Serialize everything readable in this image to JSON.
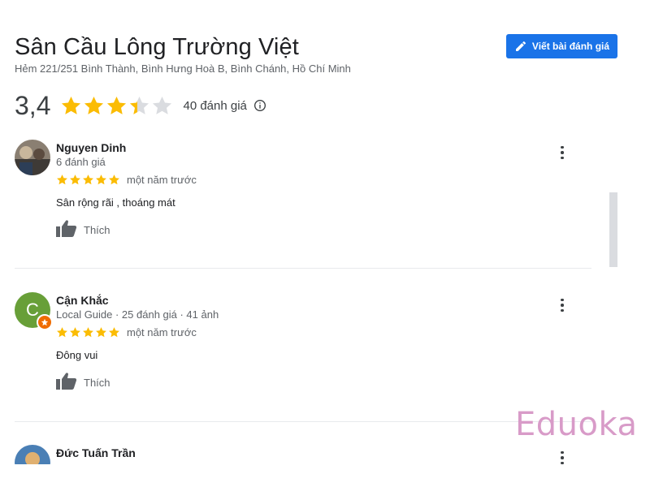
{
  "place": {
    "title": "Sân Cầu Lông Trường Việt",
    "address": "Hẻm 221/251 Bình Thành, Bình Hưng Hoà B, Bình Chánh, Hồ Chí Minh"
  },
  "write_review": {
    "label": "Viết bài đánh giá",
    "icon": "pencil-icon"
  },
  "summary": {
    "rating": "3,4",
    "rating_value": 3.4,
    "max_stars": 5,
    "count_text": "40 đánh giá",
    "info_icon": "info-icon"
  },
  "colors": {
    "accent": "#1a73e8",
    "star": "#fbbc04",
    "star_empty": "#dadce0",
    "guide_avatar": "#689f38",
    "watermark": "#d89bc8"
  },
  "reviews": [
    {
      "author": "Nguyen Dinh",
      "meta": "6 đánh giá",
      "stars": 5,
      "time": "một năm trước",
      "text": "Sân rộng rãi , thoáng mát",
      "like_label": "Thích",
      "avatar": "photo"
    },
    {
      "author": "Cận Khắc",
      "meta": "Local Guide · 25 đánh giá · 41 ảnh",
      "stars": 5,
      "time": "một năm trước",
      "text": "Đông vui",
      "like_label": "Thích",
      "avatar_letter": "C"
    },
    {
      "author": "Đức Tuấn Trần",
      "avatar": "photo"
    }
  ],
  "watermark": "Eduoka"
}
